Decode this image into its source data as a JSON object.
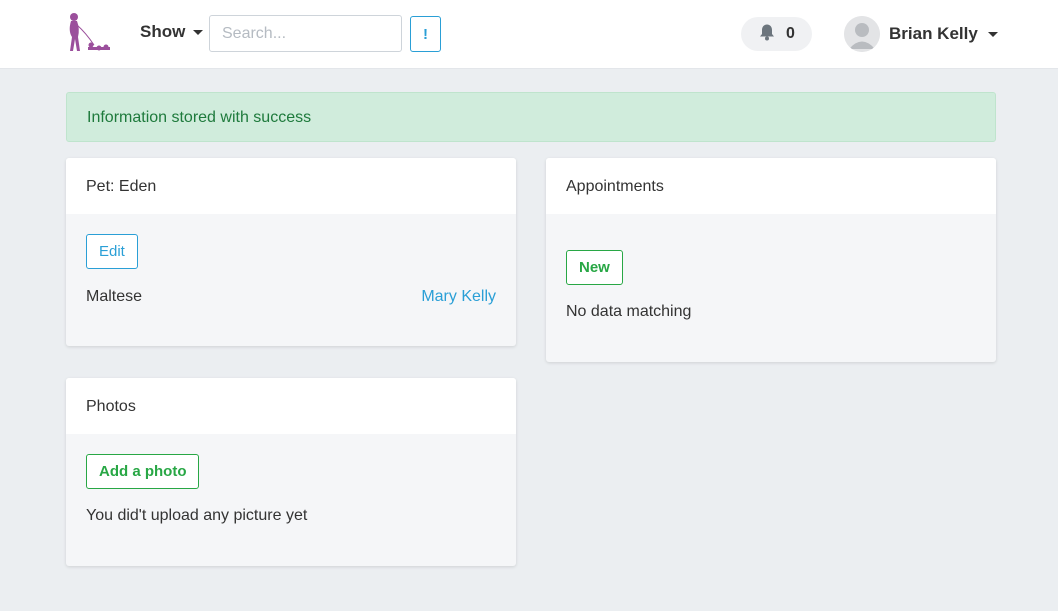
{
  "navbar": {
    "show_label": "Show",
    "search_placeholder": "Search...",
    "bang_label": "!",
    "notifications_count": "0",
    "user_name": "Brian Kelly"
  },
  "alert": {
    "message": "Information stored with success"
  },
  "pet_card": {
    "title": "Pet: Eden",
    "edit_label": "Edit",
    "breed": "Maltese",
    "owner": "Mary Kelly"
  },
  "appointments_card": {
    "title": "Appointments",
    "new_label": "New",
    "empty_text": "No data matching"
  },
  "photos_card": {
    "title": "Photos",
    "add_label": "Add a photo",
    "empty_text": "You did't upload any picture yet"
  },
  "colors": {
    "accent": "#2a9fd6",
    "success": "#28a745",
    "alert_bg": "#d0ecdc",
    "logo": "#9b4f9c"
  },
  "icons": [
    "logo-icon",
    "caret-down-icon",
    "bell-icon",
    "avatar-icon"
  ]
}
